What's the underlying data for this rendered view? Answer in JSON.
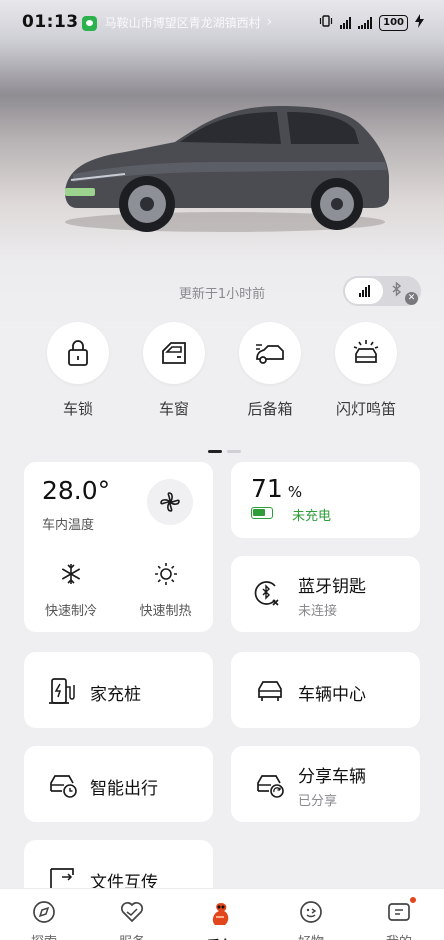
{
  "status_bar": {
    "time": "01:13",
    "location": "马鞍山市博望区青龙湖镇西村",
    "battery": "100"
  },
  "vehicle": {
    "updated_text": "更新于1小时前"
  },
  "quick_controls": [
    {
      "label": "车锁",
      "icon": "lock-icon"
    },
    {
      "label": "车窗",
      "icon": "car-window-icon"
    },
    {
      "label": "后备箱",
      "icon": "trunk-icon"
    },
    {
      "label": "闪灯鸣笛",
      "icon": "flash-horn-icon"
    }
  ],
  "climate": {
    "temperature": "28.0°",
    "temperature_label": "车内温度",
    "cool_label": "快速制冷",
    "heat_label": "快速制热"
  },
  "battery_card": {
    "percent": "71",
    "unit": "%",
    "status": "未充电",
    "level": 0.71
  },
  "bluetooth_key": {
    "title": "蓝牙钥匙",
    "subtitle": "未连接"
  },
  "tiles": {
    "home_charger": "家充桩",
    "vehicle_center": "车辆中心",
    "smart_travel": "智能出行",
    "share_vehicle": "分享车辆",
    "share_status": "已分享",
    "file_transfer": "文件互传"
  },
  "tabbar": [
    {
      "label": "探索",
      "icon": "explore-icon"
    },
    {
      "label": "服务",
      "icon": "service-icon"
    },
    {
      "label": "爱车",
      "icon": "my-car-icon"
    },
    {
      "label": "好物",
      "icon": "shop-icon"
    },
    {
      "label": "我的",
      "icon": "profile-icon"
    }
  ],
  "colors": {
    "green": "#2e9d3a",
    "accent_orange": "#e2461c"
  }
}
